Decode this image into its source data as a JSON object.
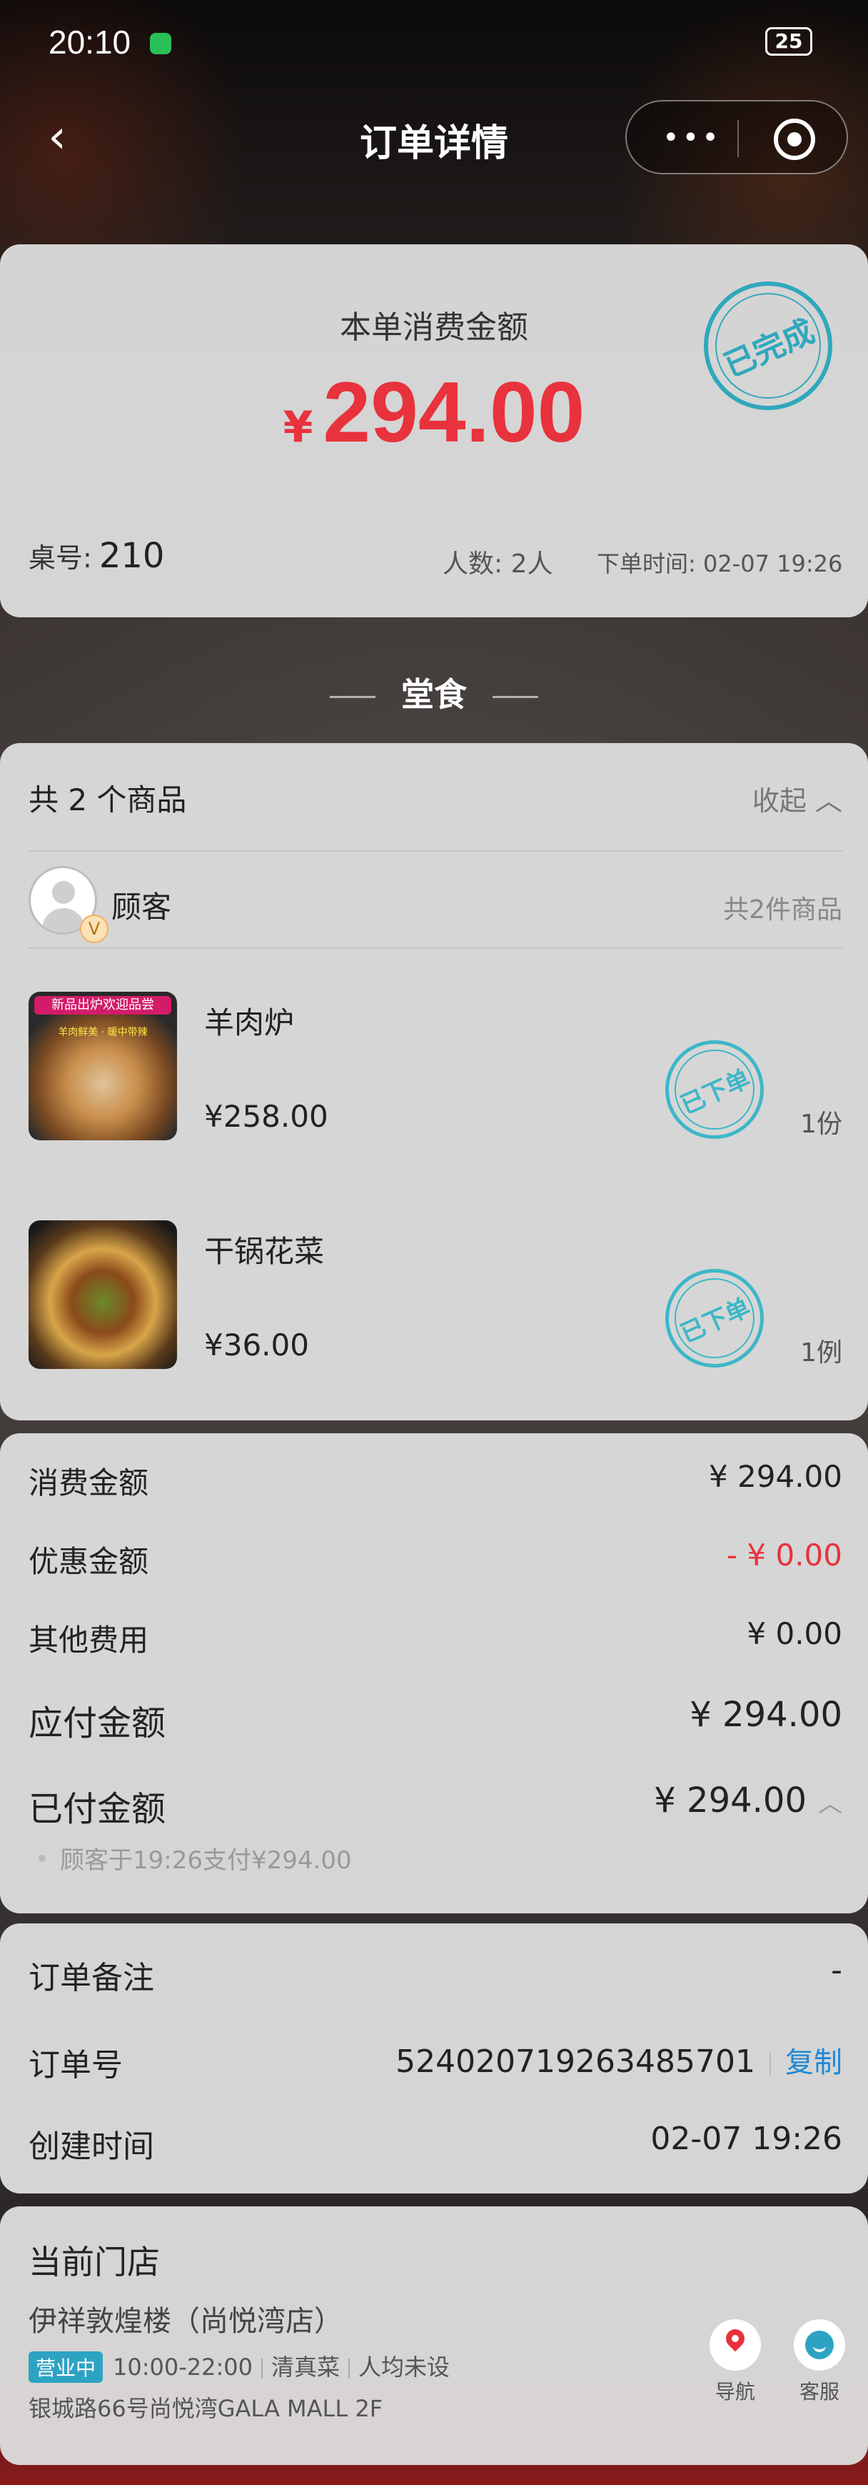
{
  "status_bar": {
    "time": "20:10",
    "battery": "25"
  },
  "nav": {
    "back_icon": "chevron-left-icon",
    "title": "订单详情",
    "more_icon": "more-dots-icon",
    "target_icon": "target-icon"
  },
  "summary": {
    "label": "本单消费金额",
    "currency": "¥",
    "amount": "294.00",
    "stamp": "已完成",
    "table_label": "桌号:",
    "table_no": "210",
    "people": "人数: 2人",
    "order_time": "下单时间: 02-07 19:26"
  },
  "dine_type": "堂食",
  "items": {
    "count_text": "共 2 个商品",
    "collapse_text": "收起 ︿",
    "customer": "顾客",
    "customer_badge": "V",
    "customer_count": "共2件商品",
    "dishes": [
      {
        "name": "羊肉炉",
        "price": "¥258.00",
        "qty": "1份",
        "stamp": "已下单",
        "image_banner": "新品出炉欢迎品尝",
        "image_sub": "羊肉鲜美 · 暖中带辣"
      },
      {
        "name": "干锅花菜",
        "price": "¥36.00",
        "qty": "1例",
        "stamp": "已下单"
      }
    ]
  },
  "payment": {
    "rows": [
      {
        "label": "消费金额",
        "value": "¥ 294.00"
      },
      {
        "label": "优惠金额",
        "value": "- ¥ 0.00"
      },
      {
        "label": "其他费用",
        "value": "¥ 0.00"
      },
      {
        "label": "应付金额",
        "value": "¥ 294.00"
      },
      {
        "label": "已付金额",
        "value": "¥ 294.00"
      }
    ],
    "paid_chevron": "︿",
    "note": "顾客于19:26支付¥294.00"
  },
  "order_info": {
    "remark_label": "订单备注",
    "remark_value": "-",
    "order_no_label": "订单号",
    "order_no": "524020719263485701",
    "copy_label": "复制",
    "created_label": "创建时间",
    "created_value": "02-07 19:26"
  },
  "store": {
    "title": "当前门店",
    "name": "伊祥敦煌楼（尚悦湾店）",
    "status": "营业中",
    "hours": "10:00-22:00",
    "cuisine": "清真菜",
    "avg": "人均未设",
    "address": "银城路66号尚悦湾GALA MALL 2F",
    "nav_label": "导航",
    "service_label": "客服"
  },
  "colors": {
    "accent_red": "#e8323c",
    "stamp_teal": "#2fa8bc",
    "link_blue": "#1e88d6"
  }
}
